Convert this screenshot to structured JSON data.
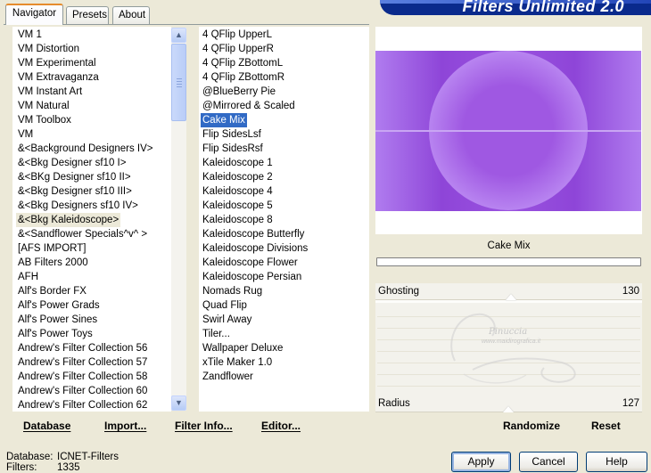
{
  "window": {
    "title": "Filters Unlimited 2.0"
  },
  "tabs": [
    {
      "label": "Navigator",
      "active": true
    },
    {
      "label": "Presets",
      "active": false
    },
    {
      "label": "About",
      "active": false
    }
  ],
  "categories": {
    "selected": "&<Bkg Kaleidoscope>",
    "items": [
      "VM 1",
      "VM Distortion",
      "VM Experimental",
      "VM Extravaganza",
      "VM Instant Art",
      "VM Natural",
      "VM Toolbox",
      "VM",
      "&<Background Designers IV>",
      "&<Bkg Designer sf10 I>",
      "&<BKg Designer sf10 II>",
      "&<Bkg Designer sf10 III>",
      "&<Bkg Designers sf10 IV>",
      "&<Bkg Kaleidoscope>",
      "&<Sandflower Specials^v^ >",
      "[AFS IMPORT]",
      "AB Filters 2000",
      "AFH",
      "Alf's Border FX",
      "Alf's Power Grads",
      "Alf's Power Sines",
      "Alf's Power Toys",
      "Andrew's Filter Collection 56",
      "Andrew's Filter Collection 57",
      "Andrew's Filter Collection 58",
      "Andrew's Filter Collection 60",
      "Andrew's Filter Collection 62"
    ]
  },
  "filters": {
    "selected": "Cake Mix",
    "items": [
      "4 QFlip UpperL",
      "4 QFlip UpperR",
      "4 QFlip ZBottomL",
      "4 QFlip ZBottomR",
      "@BlueBerry Pie",
      "@Mirrored & Scaled",
      "Cake Mix",
      "Flip SidesLsf",
      "Flip SidesRsf",
      "Kaleidoscope 1",
      "Kaleidoscope 2",
      "Kaleidoscope 4",
      "Kaleidoscope 5",
      "Kaleidoscope 8",
      "Kaleidoscope Butterfly",
      "Kaleidoscope Divisions",
      "Kaleidoscope Flower",
      "Kaleidoscope Persian",
      "Nomads Rug",
      "Quad Flip",
      "Swirl Away",
      "Tiler...",
      "Wallpaper Deluxe",
      "xTile Maker 1.0",
      "Zandflower"
    ]
  },
  "preview": {
    "filter_name": "Cake Mix",
    "progress": 0
  },
  "parameters": [
    {
      "label": "Ghosting",
      "value": "130",
      "max": 255
    },
    {
      "label": "Radius",
      "value": "127",
      "max": 255
    }
  ],
  "watermark": {
    "text": "Pinuccia",
    "sub": "www.maidirografica.it"
  },
  "left_buttons": [
    {
      "label": "Database"
    },
    {
      "label": "Import..."
    },
    {
      "label": "Filter Info..."
    },
    {
      "label": "Editor..."
    }
  ],
  "right_buttons": {
    "randomize": "Randomize",
    "reset": "Reset"
  },
  "status": {
    "database_label": "Database:",
    "database_value": "ICNET-Filters",
    "filters_label": "Filters:",
    "filters_value": "1335"
  },
  "dialog_buttons": {
    "apply": "Apply",
    "cancel": "Cancel",
    "help": "Help"
  },
  "colors": {
    "accent": "#316ac5",
    "tab_highlight": "#e68b2c",
    "preview_purple": "#9a52df",
    "banner": "#0a2a8c"
  }
}
